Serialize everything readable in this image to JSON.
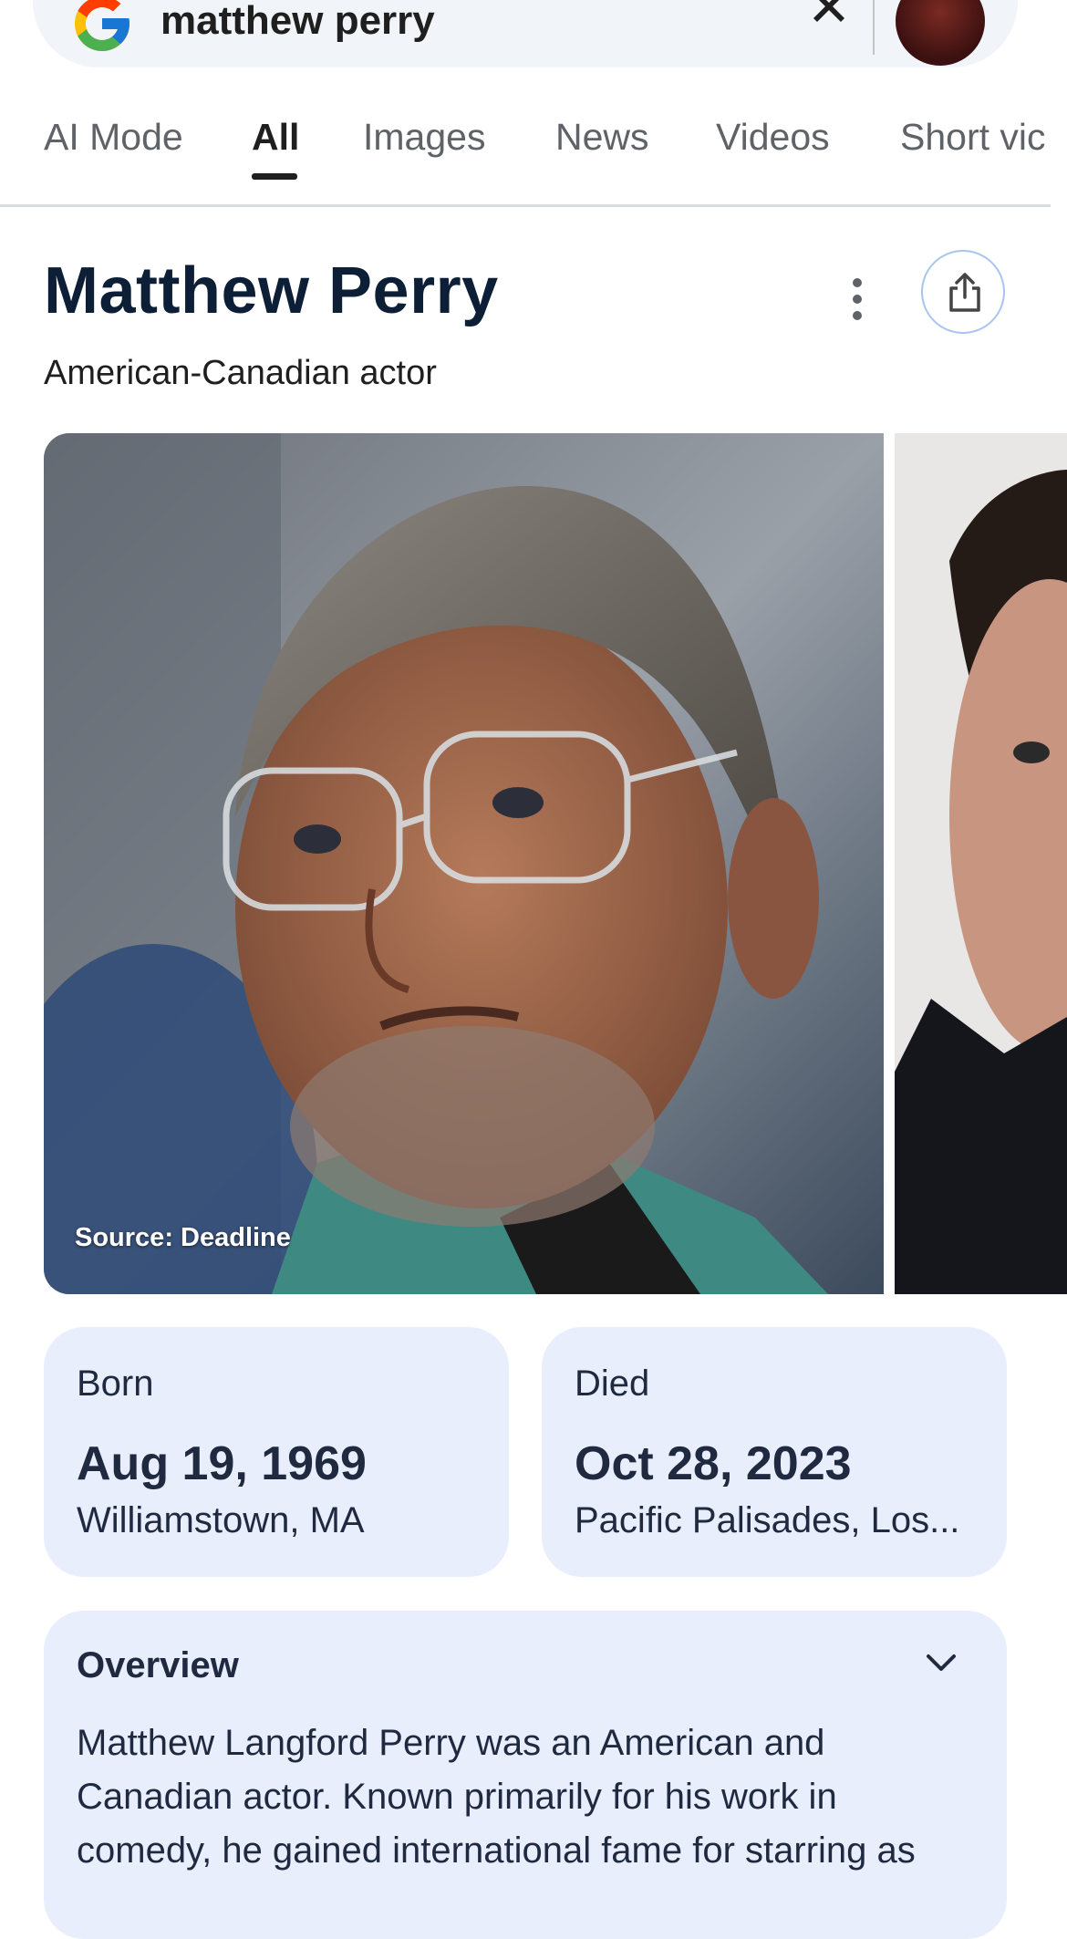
{
  "search": {
    "query": "matthew perry",
    "clear_icon": "close-icon",
    "logo_icon": "google-g-logo"
  },
  "tabs": [
    {
      "label": "AI Mode",
      "active": false
    },
    {
      "label": "All",
      "active": true
    },
    {
      "label": "Images",
      "active": false
    },
    {
      "label": "News",
      "active": false
    },
    {
      "label": "Videos",
      "active": false
    },
    {
      "label": "Short vic",
      "active": false
    }
  ],
  "entity": {
    "name": "Matthew Perry",
    "subtitle": "American-Canadian actor",
    "more_icon": "more-vert-icon",
    "share_icon": "share-icon"
  },
  "images": {
    "main_caption": "Source: Deadline"
  },
  "facts": {
    "born": {
      "label": "Born",
      "date": "Aug 19, 1969",
      "place": "Williamstown, MA"
    },
    "died": {
      "label": "Died",
      "date": "Oct 28, 2023",
      "place": "Pacific Palisades, Los..."
    }
  },
  "overview": {
    "title": "Overview",
    "text": "Matthew Langford Perry was an American and Canadian actor. Known primarily for his work in comedy, he gained international fame for starring as",
    "expand_icon": "chevron-down-icon"
  },
  "colors": {
    "card_bg": "#e8eefc",
    "title_color": "#0c1f36",
    "share_border": "#a8c4f0"
  }
}
